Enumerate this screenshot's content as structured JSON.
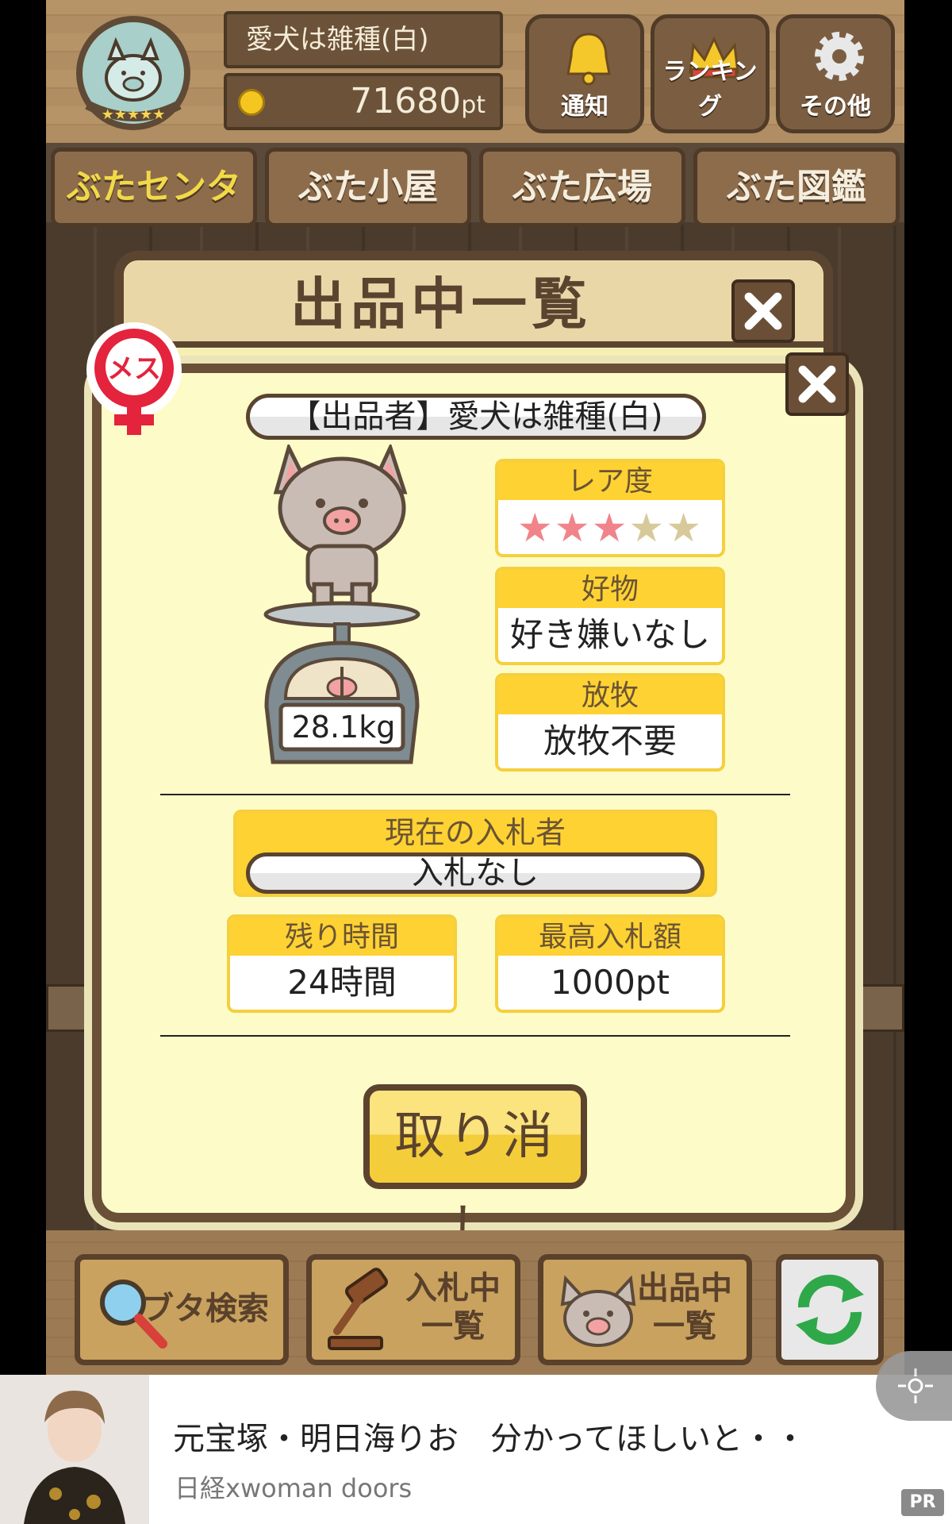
{
  "header": {
    "user_name": "愛犬は雑種(白)",
    "points": "71680",
    "points_unit": "pt",
    "buttons": [
      {
        "label": "通知",
        "icon": "bell-icon"
      },
      {
        "label": "ランキング",
        "icon": "crown-icon"
      },
      {
        "label": "その他",
        "icon": "gear-icon"
      }
    ]
  },
  "tabs": [
    {
      "label": "ぶたセンター",
      "active": true
    },
    {
      "label": "ぶた小屋",
      "active": false
    },
    {
      "label": "ぶた広場",
      "active": false
    },
    {
      "label": "ぶた図鑑",
      "active": false
    }
  ],
  "list_window": {
    "title": "出品中一覧"
  },
  "dialog": {
    "gender_badge": "メス",
    "seller": "【出品者】愛犬は雑種(白)",
    "weight": "28.1kg",
    "rarity": {
      "label": "レア度",
      "stars_total": 5,
      "stars_filled": 3,
      "star_glyph": "★"
    },
    "favorite": {
      "label": "好物",
      "value": "好き嫌いなし"
    },
    "grazing": {
      "label": "放牧",
      "value": "放牧不要"
    },
    "current_bidder": {
      "label": "現在の入札者",
      "value": "入札なし"
    },
    "time_left": {
      "label": "残り時間",
      "value": "24時間"
    },
    "highest_bid": {
      "label": "最高入札額",
      "value": "1000pt"
    },
    "cancel_label": "取り消し"
  },
  "bottom_buttons": [
    {
      "label_line1": "ブタ検索",
      "label_line2": "",
      "icon": "magnifier-icon"
    },
    {
      "label_line1": "入札中",
      "label_line2": "一覧",
      "icon": "gavel-icon"
    },
    {
      "label_line1": "出品中",
      "label_line2": "一覧",
      "icon": "pig-face-icon"
    }
  ],
  "ad": {
    "title": "元宝塚・明日海りお　分かってほしいと・・",
    "source": "日経xwoman doors",
    "pr_label": "PR"
  },
  "colors": {
    "wood": "#b08d62",
    "dialog_bg": "#fdfcc8",
    "card_header": "#ffd233",
    "star_on": "#f0848a",
    "star_off": "#d8c99a",
    "active_tab": "#f2d949"
  }
}
